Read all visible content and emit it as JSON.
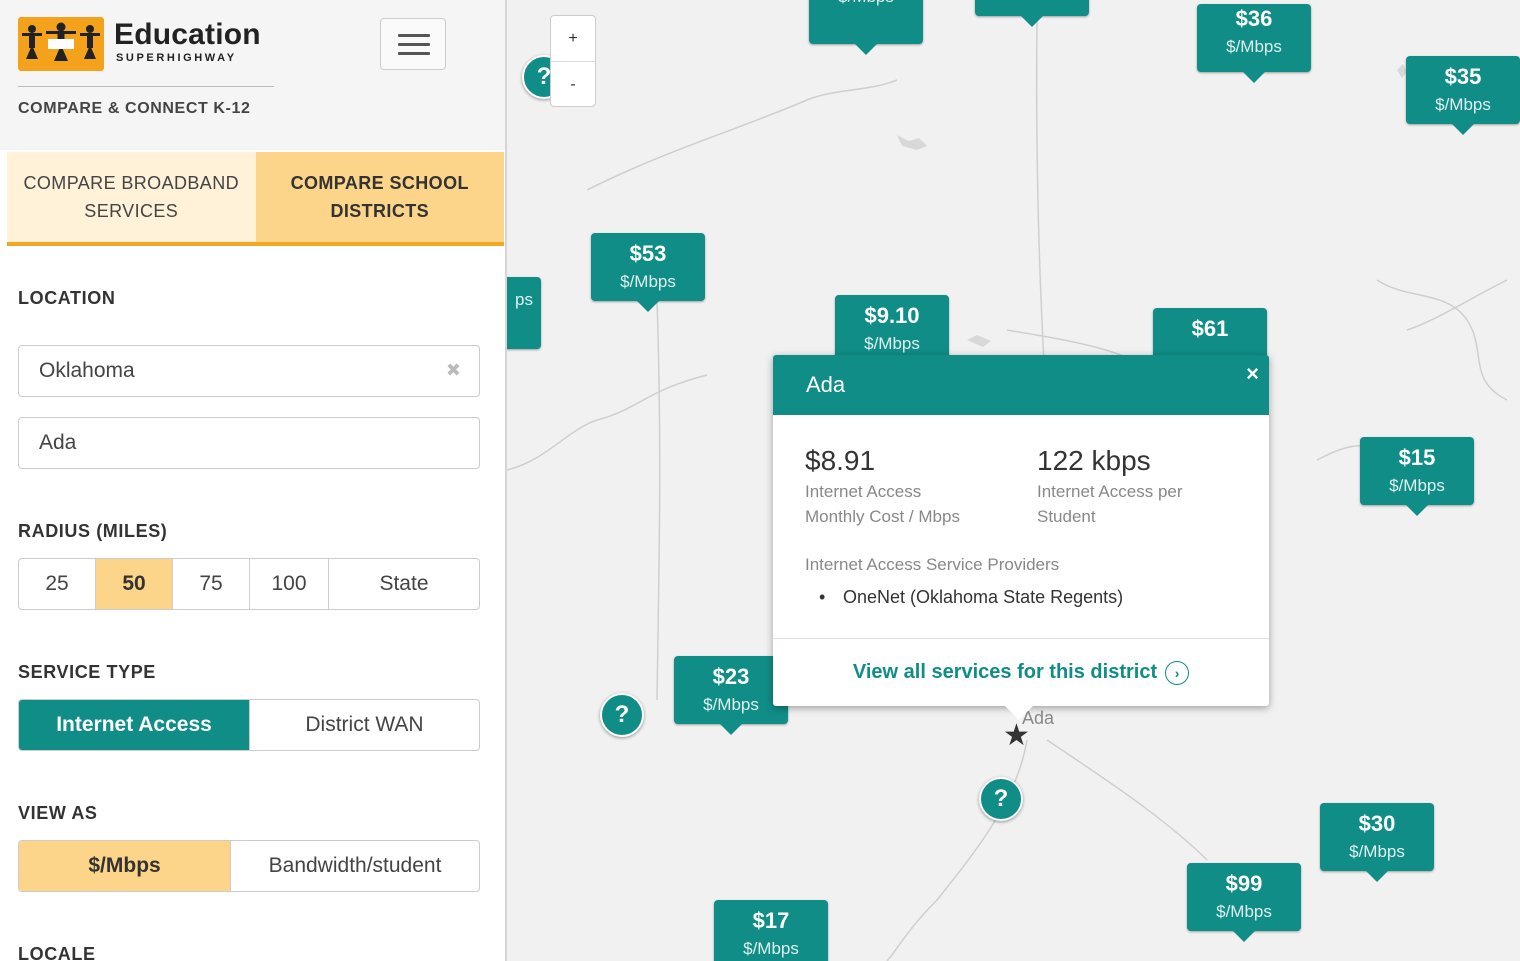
{
  "brand": {
    "title": "Education",
    "subtitle": "SUPERHIGHWAY",
    "tagline": "COMPARE & CONNECT K-12"
  },
  "tabs": [
    {
      "label": "COMPARE BROADBAND SERVICES",
      "active": false
    },
    {
      "label": "COMPARE SCHOOL DISTRICTS",
      "active": true
    }
  ],
  "location": {
    "label": "LOCATION",
    "state_value": "Oklahoma",
    "district_value": "Ada"
  },
  "radius": {
    "label": "RADIUS (MILES)",
    "options": [
      "25",
      "50",
      "75",
      "100",
      "State"
    ],
    "selected": "50"
  },
  "service_type": {
    "label": "SERVICE TYPE",
    "options": [
      "Internet Access",
      "District WAN"
    ],
    "selected": "Internet Access"
  },
  "view_as": {
    "label": "VIEW AS",
    "options": [
      "$/Mbps",
      "Bandwidth/student"
    ],
    "selected": "$/Mbps"
  },
  "locale": {
    "label": "LOCALE"
  },
  "map": {
    "zoom_in": "+",
    "zoom_out": "-",
    "unit": "$/Mbps",
    "pins": [
      {
        "value": "",
        "unit": "$/Mbps"
      },
      {
        "value": "$36",
        "unit": "$/Mbps"
      },
      {
        "value": "$35",
        "unit": "$/Mbps"
      },
      {
        "value": "$53",
        "unit": "$/Mbps"
      },
      {
        "value": "",
        "unit": "ps"
      },
      {
        "value": "$9.10",
        "unit": "$/Mbps"
      },
      {
        "value": "$61",
        "unit": ""
      },
      {
        "value": "$15",
        "unit": "$/Mbps"
      },
      {
        "value": "$23",
        "unit": "$/Mbps"
      },
      {
        "value": "$30",
        "unit": "$/Mbps"
      },
      {
        "value": "$99",
        "unit": "$/Mbps"
      },
      {
        "value": "$17",
        "unit": "$/Mbps"
      }
    ],
    "unknown_marker": "?",
    "place_label": "Ada",
    "selected_marker": "★"
  },
  "popup": {
    "title": "Ada",
    "close": "×",
    "cost_value": "$8.91",
    "cost_label_1": "Internet Access",
    "cost_label_2": "Monthly Cost / Mbps",
    "bw_value": "122 kbps",
    "bw_label_1": "Internet Access per",
    "bw_label_2": "Student",
    "providers_title": "Internet Access Service Providers",
    "providers": [
      "OneNet (Oklahoma State Regents)"
    ],
    "footer_link": "View all services for this district",
    "footer_icon": "›"
  },
  "colors": {
    "teal": "#108d87",
    "orange": "#f5a623",
    "orange_light": "#fcd58a"
  }
}
